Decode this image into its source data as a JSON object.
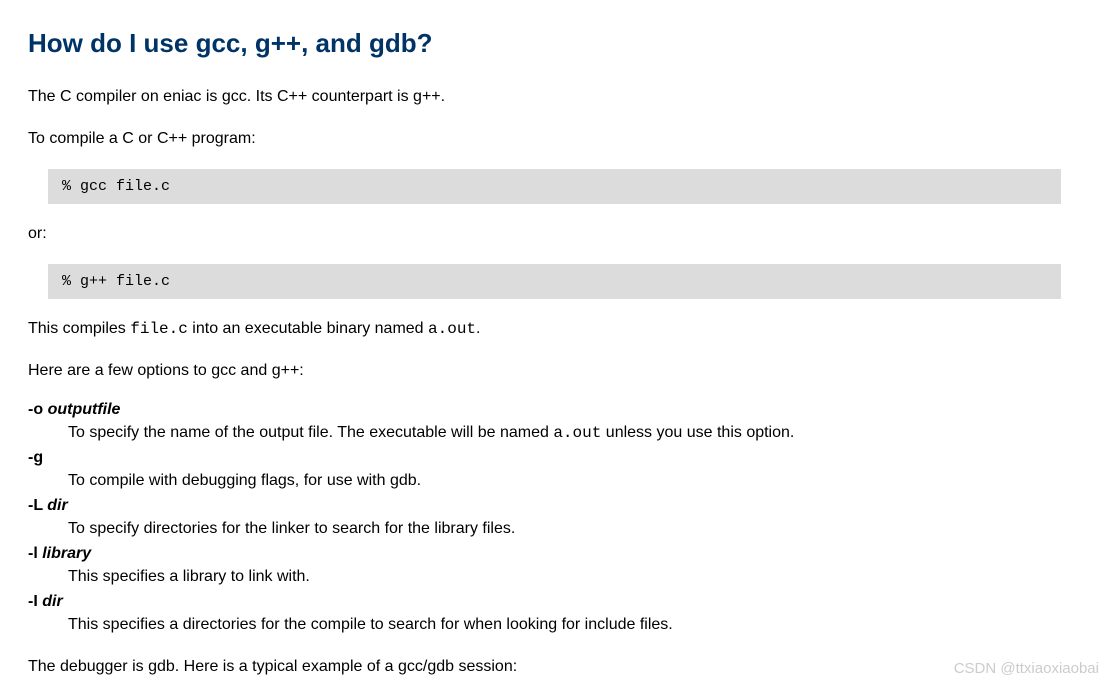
{
  "heading": "How do I use gcc, g++, and gdb?",
  "para1": "The C compiler on eniac is gcc. Its C++ counterpart is g++.",
  "para2": "To compile a C or C++ program:",
  "code1": "% gcc file.c",
  "para3": "or:",
  "code2": "% g++ file.c",
  "para4_a": "This compiles ",
  "para4_code1": "file.c",
  "para4_b": " into an executable binary named ",
  "para4_code2": "a.out",
  "para4_c": ".",
  "para5": "Here are a few options to gcc and g++:",
  "options": [
    {
      "flag": "-o",
      "arg": "outputfile",
      "desc_a": "To specify the name of the output file. The executable will be named ",
      "desc_code": "a.out",
      "desc_b": " unless you use this option."
    },
    {
      "flag": "-g",
      "arg": "",
      "desc_a": "To compile with debugging flags, for use with gdb.",
      "desc_code": "",
      "desc_b": ""
    },
    {
      "flag": "-L",
      "arg": "dir",
      "desc_a": "To specify directories for the linker to search for the library files.",
      "desc_code": "",
      "desc_b": ""
    },
    {
      "flag": "-l",
      "arg": "library",
      "desc_a": "This specifies a library to link with.",
      "desc_code": "",
      "desc_b": ""
    },
    {
      "flag": "-I",
      "arg": "dir",
      "desc_a": "This specifies a directories for the compile to search for when looking for include files.",
      "desc_code": "",
      "desc_b": ""
    }
  ],
  "para6": "The debugger is gdb. Here is a typical example of a gcc/gdb session:",
  "watermark": "CSDN @ttxiaoxiaobai"
}
